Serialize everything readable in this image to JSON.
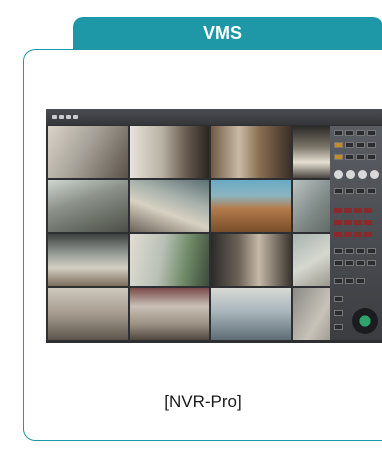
{
  "tab": {
    "title": "VMS"
  },
  "product": {
    "caption": "[NVR-Pro]"
  },
  "camera_feeds": [
    "camera-1",
    "camera-2",
    "camera-3",
    "camera-4",
    "camera-5",
    "camera-6",
    "camera-7",
    "camera-8",
    "camera-9",
    "camera-10",
    "camera-11",
    "camera-12",
    "camera-13",
    "camera-14",
    "camera-15",
    "camera-16"
  ],
  "colors": {
    "accent": "#1e98a6",
    "screen_bg": "#2e2f33"
  }
}
